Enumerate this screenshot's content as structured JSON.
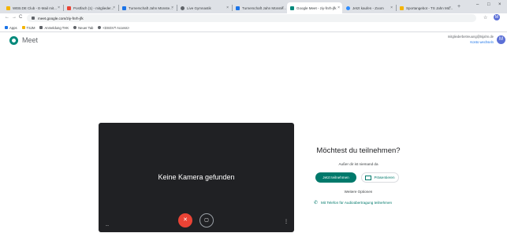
{
  "browser": {
    "tabs": [
      {
        "label": "WEB.DE Club - E-Mail mit...",
        "color": "#f4b400"
      },
      {
        "label": "Postfach (1) - mitglieder...",
        "color": "#ea4335"
      },
      {
        "label": "Turnerschaft Jahn Münste...",
        "color": "#1a73e8"
      },
      {
        "label": "Live Gymnastik",
        "color": "#5f6368"
      },
      {
        "label": "Turnerschaft Jahn Münste...",
        "color": "#1a73e8"
      },
      {
        "label": "Google Meet - ziy-fnrh-jfk",
        "color": "#00897b"
      },
      {
        "label": "Jetzt kaufen - Zoom",
        "color": "#2d8cff"
      },
      {
        "label": "Sportangebot - TS Jahn Mü...",
        "color": "#f4b400"
      }
    ],
    "close_glyph": "×",
    "new_tab_glyph": "+",
    "window_controls": [
      "–",
      "□",
      "×"
    ],
    "nav": {
      "back": "←",
      "forward": "→",
      "reload": "C"
    },
    "url": "meet.google.com/ziy-fnrh-jfk",
    "star_glyph": "☆",
    "profile_initial": "M",
    "bookmarks": [
      {
        "label": "Apps",
        "color": "#1a73e8"
      },
      {
        "label": "TSJM",
        "color": "#f4b400"
      },
      {
        "label": "Anmeldung THK",
        "color": "#5f6368"
      },
      {
        "label": "Neuer Tab",
        "color": "#5f6368"
      },
      {
        "label": "<DSGVT Access>",
        "color": "#5f6368"
      }
    ]
  },
  "meet": {
    "title": "Meet",
    "account_email": "mitgliederbetreuung@tsjahn.de",
    "account_switch": "Konto wechseln",
    "account_initial": "M"
  },
  "preview": {
    "no_camera": "Keine Kamera gefunden",
    "mic_glyph": "✕",
    "cam_glyph": "▢",
    "dots_left": "···",
    "dots_right": "⋮"
  },
  "join": {
    "title": "Möchtest du teilnehmen?",
    "nobody_here": "Außer dir ist niemand da",
    "join_button": "Jetzt teilnehmen",
    "present_button": "Präsentieren",
    "more_options": "Weitere Optionen",
    "phone_glyph": "✆",
    "phone_option": "Mit Telefon für Audioübertragung teilnehmen"
  }
}
